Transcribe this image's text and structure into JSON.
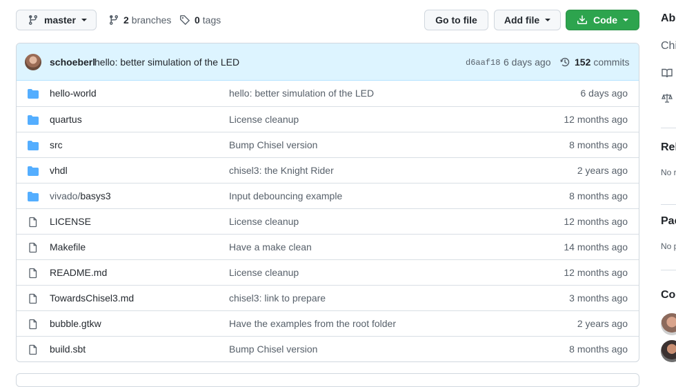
{
  "toolbar": {
    "branch_name": "master",
    "branches_count": "2",
    "branches_label": "branches",
    "tags_count": "0",
    "tags_label": "tags",
    "goto_label": "Go to file",
    "add_file_label": "Add file",
    "code_label": "Code"
  },
  "latest_commit": {
    "author": "schoeberl",
    "message": "hello: better simulation of the LED",
    "sha": "d6aaf18",
    "time": "6 days ago",
    "count": "152",
    "count_label": "commits"
  },
  "files": [
    {
      "type": "folder",
      "name": "hello-world",
      "prefix": "",
      "message": "hello: better simulation of the LED",
      "age": "6 days ago"
    },
    {
      "type": "folder",
      "name": "quartus",
      "prefix": "",
      "message": "License cleanup",
      "age": "12 months ago"
    },
    {
      "type": "folder",
      "name": "src",
      "prefix": "",
      "message": "Bump Chisel version",
      "age": "8 months ago"
    },
    {
      "type": "folder",
      "name": "vhdl",
      "prefix": "",
      "message": "chisel3: the Knight Rider",
      "age": "2 years ago"
    },
    {
      "type": "folder",
      "name": "basys3",
      "prefix": "vivado/",
      "message": "Input debouncing example",
      "age": "8 months ago"
    },
    {
      "type": "file",
      "name": "LICENSE",
      "prefix": "",
      "message": "License cleanup",
      "age": "12 months ago"
    },
    {
      "type": "file",
      "name": "Makefile",
      "prefix": "",
      "message": "Have a make clean",
      "age": "14 months ago"
    },
    {
      "type": "file",
      "name": "README.md",
      "prefix": "",
      "message": "License cleanup",
      "age": "12 months ago"
    },
    {
      "type": "file",
      "name": "TowardsChisel3.md",
      "prefix": "",
      "message": "chisel3: link to prepare",
      "age": "3 months ago"
    },
    {
      "type": "file",
      "name": "bubble.gtkw",
      "prefix": "",
      "message": "Have the examples from the root folder",
      "age": "2 years ago"
    },
    {
      "type": "file",
      "name": "build.sbt",
      "prefix": "",
      "message": "Bump Chisel version",
      "age": "8 months ago"
    }
  ],
  "sidebar": {
    "about_heading": "Ab",
    "about_text": "Chi",
    "releases_heading": "Rel",
    "releases_text": "No r",
    "packages_heading": "Pac",
    "packages_text": "No p",
    "contributors_heading": "Cor"
  },
  "colors": {
    "folder": "#54aeff",
    "accent_green": "#2da44e",
    "commit_bar": "#ddf4ff"
  }
}
